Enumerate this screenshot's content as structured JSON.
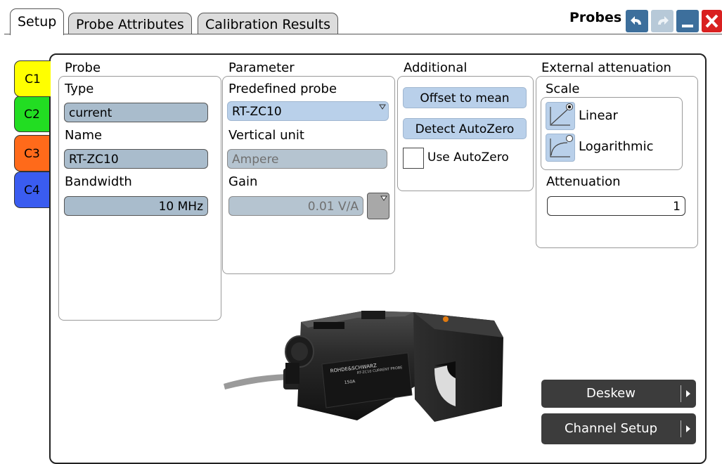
{
  "tabs": [
    "Setup",
    "Probe Attributes",
    "Calibration Results"
  ],
  "window": {
    "title": "Probes"
  },
  "channels": [
    "C1",
    "C2",
    "C3",
    "C4"
  ],
  "probe": {
    "heading": "Probe",
    "type_label": "Type",
    "type_value": "current",
    "name_label": "Name",
    "name_value": "RT-ZC10",
    "bandwidth_label": "Bandwidth",
    "bandwidth_value": "10 MHz"
  },
  "parameter": {
    "heading": "Parameter",
    "predefined_label": "Predefined probe",
    "predefined_value": "RT-ZC10",
    "vertical_unit_label": "Vertical unit",
    "vertical_unit_value": "Ampere",
    "gain_label": "Gain",
    "gain_value": "0.01 V/A"
  },
  "additional": {
    "heading": "Additional",
    "offset_button": "Offset to mean",
    "detect_button": "Detect AutoZero",
    "use_autozero_label": "Use AutoZero",
    "use_autozero_checked": false
  },
  "external_attenuation": {
    "heading": "External attenuation",
    "scale_label": "Scale",
    "linear_label": "Linear",
    "log_label": "Logarithmic",
    "selected": "Linear",
    "attenuation_label": "Attenuation",
    "attenuation_value": "1"
  },
  "probe_image": {
    "brand": "ROHDE&SCHWARZ",
    "model": "RT-ZC10 CURRENT PROBE",
    "rating": "150A"
  },
  "buttons": {
    "deskew": "Deskew",
    "channel_setup": "Channel Setup"
  },
  "colors": {
    "c1": "#ffff00",
    "c2": "#22dd22",
    "c3": "#ff6a1a",
    "c4": "#3a5cf0",
    "field": "#a9bccc",
    "button": "#b9d0ea"
  }
}
